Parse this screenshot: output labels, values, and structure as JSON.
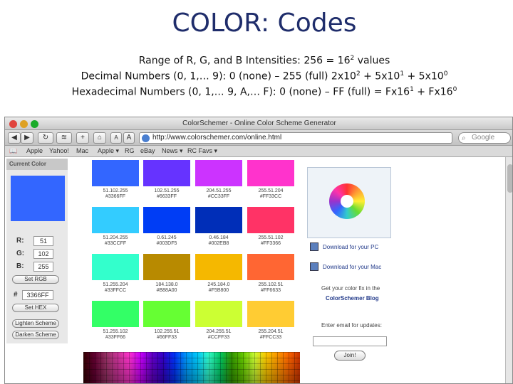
{
  "slide": {
    "title": "COLOR: Codes",
    "line1_text": "Range of R, G, and B Intensities: 256 = 16",
    "line1_sup": "2",
    "line1_tail": " values",
    "line2_a": "Decimal Numbers (0, 1,… 9): 0 (none) – 255 (full) 2x10",
    "line2_s1": "2",
    "line2_b": " + 5x10",
    "line2_s2": "1",
    "line2_c": " + 5x10",
    "line2_s3": "0",
    "line3_a": "Hexadecimal Numbers (0, 1,… 9, A,… F): 0 (none) – FF (full) = Fx16",
    "line3_s1": "1",
    "line3_b": " + Fx16",
    "line3_s2": "0"
  },
  "browser": {
    "window_title": "ColorSchemer - Online Color Scheme Generator",
    "url": "http://www.colorschemer.com/online.html",
    "search_placeholder": "Google",
    "bookmarks": [
      "Apple",
      "Yahoo!",
      "Mac",
      "Apple ▾",
      "RG",
      "eBay",
      "News ▾",
      "RC Favs ▾"
    ]
  },
  "left_panel": {
    "header": "Current Color",
    "r_label": "R:",
    "r_value": "51",
    "g_label": "G:",
    "g_value": "102",
    "b_label": "B:",
    "b_value": "255",
    "set_rgb": "Set RGB",
    "hash": "#",
    "hex_value": "3366FF",
    "set_hex": "Set HEX",
    "lighten": "Lighten Scheme",
    "darken": "Darken Scheme"
  },
  "swatches": [
    {
      "color": "#3366ff",
      "rgb": "51.102.255",
      "hex": "#3366FF"
    },
    {
      "color": "#6633ff",
      "rgb": "102.51.255",
      "hex": "#6633FF"
    },
    {
      "color": "#cc33ff",
      "rgb": "204.51.255",
      "hex": "#CC33FF"
    },
    {
      "color": "#ff33cc",
      "rgb": "255.51.204",
      "hex": "#FF33CC"
    },
    {
      "color": "#33ccff",
      "rgb": "51.204.255",
      "hex": "#33CCFF"
    },
    {
      "color": "#003df5",
      "rgb": "0.61.245",
      "hex": "#003DF5"
    },
    {
      "color": "#002eb8",
      "rgb": "0.46.184",
      "hex": "#002EB8"
    },
    {
      "color": "#ff3366",
      "rgb": "255.51.102",
      "hex": "#FF3366"
    },
    {
      "color": "#33ffcc",
      "rgb": "51.255.204",
      "hex": "#33FFCC"
    },
    {
      "color": "#b88a00",
      "rgb": "184.138.0",
      "hex": "#B88A00"
    },
    {
      "color": "#f5b800",
      "rgb": "245.184.0",
      "hex": "#F5B800"
    },
    {
      "color": "#ff6633",
      "rgb": "255.102.51",
      "hex": "#FF6633"
    },
    {
      "color": "#33ff66",
      "rgb": "51.255.102",
      "hex": "#33FF66"
    },
    {
      "color": "#66ff33",
      "rgb": "102.255.51",
      "hex": "#66FF33"
    },
    {
      "color": "#ccff33",
      "rgb": "204.255.51",
      "hex": "#CCFF33"
    },
    {
      "color": "#ffcc33",
      "rgb": "255.204.51",
      "hex": "#FFCC33"
    }
  ],
  "sidebar": {
    "download_pc": "Download for your PC",
    "download_mac": "Download for your Mac",
    "fix_line": "Get your color fix in the",
    "blog": "ColorSchemer Blog",
    "email_label": "Enter email for updates:",
    "join": "Join!"
  }
}
